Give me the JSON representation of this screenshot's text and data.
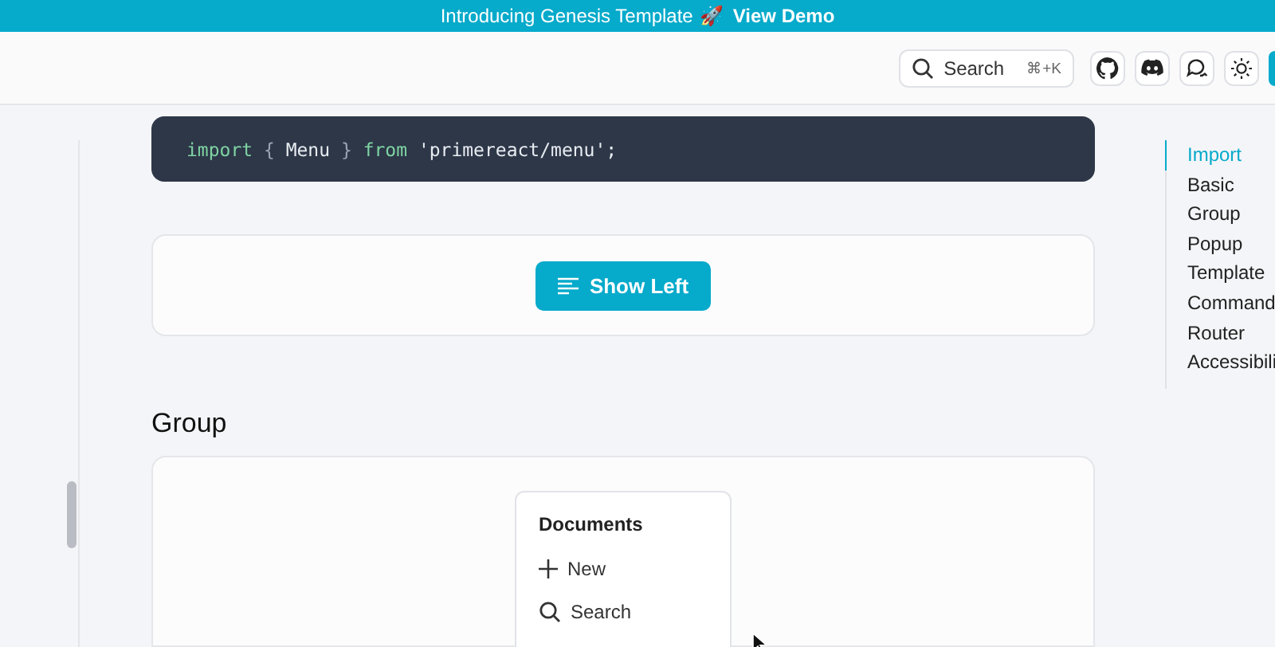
{
  "banner": {
    "text": "Introducing Genesis Template",
    "emoji": "🚀",
    "link": "View Demo"
  },
  "header": {
    "search": {
      "label": "Search",
      "shortcut": "⌘+K"
    }
  },
  "code": [
    {
      "text": "import",
      "kind": "keyword"
    },
    {
      "text": " { ",
      "kind": "punct"
    },
    {
      "text": "Menu",
      "kind": "ident"
    },
    {
      "text": " } ",
      "kind": "punct"
    },
    {
      "text": "from",
      "kind": "keyword"
    },
    {
      "text": " 'primereact/menu';",
      "kind": "string"
    }
  ],
  "basic_demo": {
    "button": "Show Left"
  },
  "group_section": {
    "title": "Group",
    "menu": {
      "heading": "Documents",
      "items": [
        {
          "label": "New",
          "kind": "plus"
        },
        {
          "label": "Search",
          "kind": "search"
        }
      ]
    }
  },
  "toc": [
    {
      "label": "Import",
      "selected": true
    },
    {
      "label": "Basic",
      "selected": false
    },
    {
      "label": "Group",
      "selected": false
    },
    {
      "label": "Popup",
      "selected": false
    },
    {
      "label": "Template",
      "selected": false
    },
    {
      "label": "Command",
      "selected": false
    },
    {
      "label": "Router",
      "selected": false
    },
    {
      "label": "Accessibili",
      "selected": false
    }
  ]
}
